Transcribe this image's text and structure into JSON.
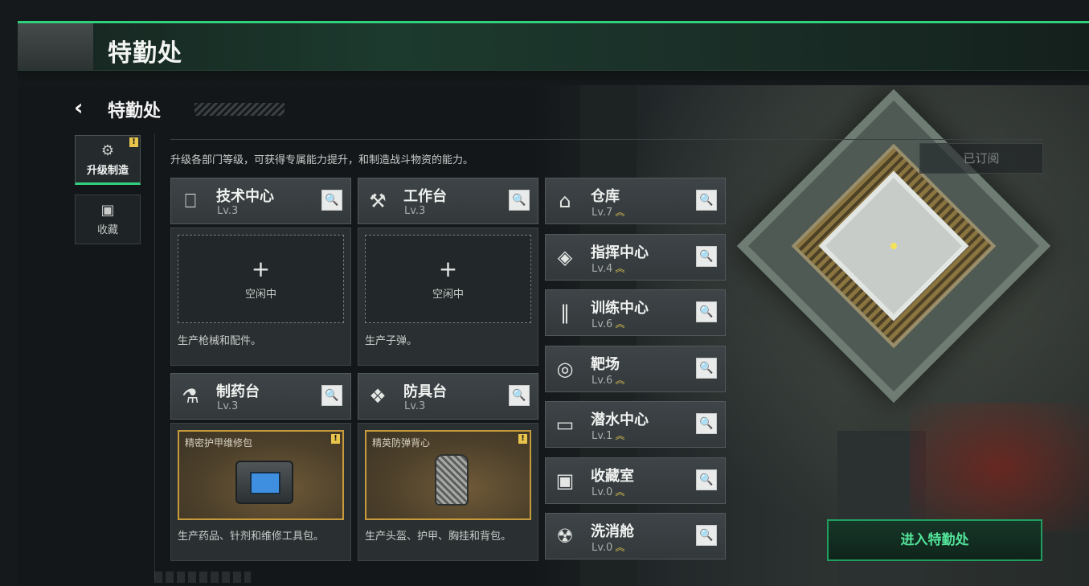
{
  "header": {
    "title": "特勤处"
  },
  "nav": {
    "back_title": "特勤处"
  },
  "side_tabs": [
    {
      "label": "升级制造",
      "icon": "upgrade-gear-icon",
      "badge": "!"
    },
    {
      "label": "收藏",
      "icon": "collection-icon"
    }
  ],
  "description": "升级各部门等级，可获得专属能力提升，和制造战斗物资的能力。",
  "subscribed_label": "已订阅",
  "production": [
    {
      "name": "技术中心",
      "level": "Lv.3",
      "icon": "tech-center-icon",
      "slot": {
        "state": "empty",
        "plus": "+",
        "text": "空闲中"
      },
      "desc": "生产枪械和配件。"
    },
    {
      "name": "工作台",
      "level": "Lv.3",
      "icon": "workbench-icon",
      "slot": {
        "state": "empty",
        "plus": "+",
        "text": "空闲中"
      },
      "desc": "生产子弹。"
    },
    {
      "name": "制药台",
      "level": "Lv.3",
      "icon": "pharmacy-icon",
      "slot": {
        "state": "item",
        "item": "精密护甲维修包",
        "badge": "!"
      },
      "desc": "生产药品、针剂和维修工具包。"
    },
    {
      "name": "防具台",
      "level": "Lv.3",
      "icon": "armor-bench-icon",
      "slot": {
        "state": "item",
        "item": "精英防弹背心",
        "badge": "!"
      },
      "desc": "生产头盔、护甲、胸挂和背包。"
    }
  ],
  "facilities": [
    {
      "name": "仓库",
      "level": "Lv.7",
      "icon": "warehouse-icon"
    },
    {
      "name": "指挥中心",
      "level": "Lv.4",
      "icon": "command-center-icon"
    },
    {
      "name": "训练中心",
      "level": "Lv.6",
      "icon": "training-center-icon"
    },
    {
      "name": "靶场",
      "level": "Lv.6",
      "icon": "shooting-range-icon"
    },
    {
      "name": "潜水中心",
      "level": "Lv.1",
      "icon": "diving-center-icon"
    },
    {
      "name": "收藏室",
      "level": "Lv.0",
      "icon": "collection-room-icon"
    },
    {
      "name": "洗消舱",
      "level": "Lv.0",
      "icon": "decontamination-icon"
    }
  ],
  "upgrade_symbol": "︽",
  "search_symbol": "🔍",
  "enter_button": "进入特勤处",
  "colors": {
    "accent_green": "#2fd07e",
    "gold_border": "#c79a3c",
    "badge_yellow": "#e8c44b"
  }
}
